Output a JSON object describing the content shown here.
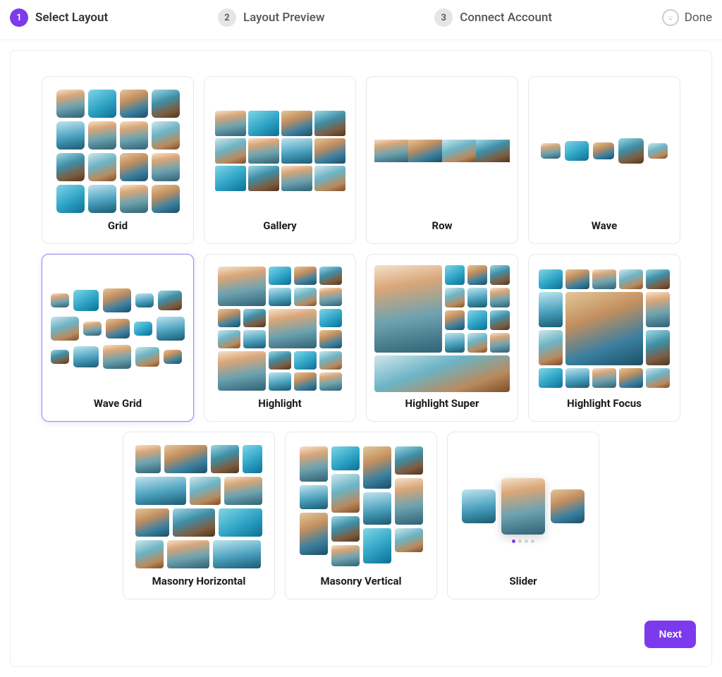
{
  "stepper": {
    "steps": [
      {
        "num": "1",
        "label": "Select Layout",
        "active": true
      },
      {
        "num": "2",
        "label": "Layout Preview",
        "active": false
      },
      {
        "num": "3",
        "label": "Connect Account",
        "active": false
      }
    ],
    "done_label": "Done"
  },
  "layouts": {
    "grid": "Grid",
    "gallery": "Gallery",
    "row": "Row",
    "wave": "Wave",
    "wave_grid": "Wave Grid",
    "highlight": "Highlight",
    "highlight_super": "Highlight Super",
    "highlight_focus": "Highlight Focus",
    "masonry_h": "Masonry Horizontal",
    "masonry_v": "Masonry Vertical",
    "slider": "Slider"
  },
  "selected_layout": "wave_grid",
  "footer": {
    "next_label": "Next"
  },
  "colors": {
    "accent": "#7c3aed"
  }
}
